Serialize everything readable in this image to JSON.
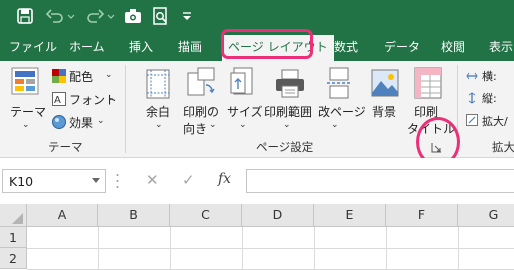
{
  "tabs": [
    {
      "label": "ファイル"
    },
    {
      "label": "ホーム"
    },
    {
      "label": "挿入"
    },
    {
      "label": "描画"
    },
    {
      "label": "ページ レイアウト",
      "active": true
    },
    {
      "label": "数式"
    },
    {
      "label": "データ"
    },
    {
      "label": "校閲"
    },
    {
      "label": "表示"
    }
  ],
  "ribbon": {
    "theme_group": {
      "label": "テーマ",
      "theme_btn": "テーマ",
      "colors": "配色",
      "fonts": "フォント",
      "effects": "効果"
    },
    "page_setup_group": {
      "label": "ページ設定",
      "margins": "余白",
      "orientation_1": "印刷の",
      "orientation_2": "向き",
      "size": "サイズ",
      "print_area": "印刷範囲",
      "breaks": "改ページ",
      "background": "背景",
      "titles_1": "印刷",
      "titles_2": "タイトル"
    },
    "scale_group": {
      "label": "拡大",
      "width": "横:",
      "height": "縦:",
      "scale": "拡大/"
    }
  },
  "formula_bar": {
    "name_box": "K10",
    "cancel_glyph": "✕",
    "enter_glyph": "✓",
    "fx": "fx",
    "value": ""
  },
  "grid": {
    "columns": [
      "A",
      "B",
      "C",
      "D",
      "E",
      "F",
      "G"
    ],
    "rows": [
      "1",
      "2"
    ]
  },
  "colors": {
    "excel_green": "#217346",
    "annotation": "#ec2f79"
  }
}
